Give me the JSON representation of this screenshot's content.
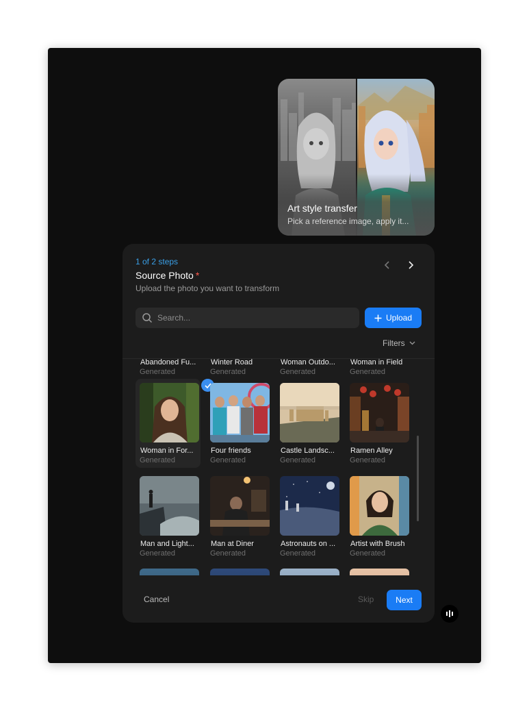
{
  "style_card": {
    "title": "Art style transfer",
    "description": "Pick a reference image, apply it..."
  },
  "dialog": {
    "step_label": "1 of 2 steps",
    "title": "Source Photo",
    "required_mark": "*",
    "subtitle": "Upload the photo you want to transform",
    "search_placeholder": "Search...",
    "upload_label": "Upload",
    "filters_label": "Filters",
    "cancel_label": "Cancel",
    "skip_label": "Skip",
    "next_label": "Next"
  },
  "gallery": {
    "partial_top": [
      {
        "name": "Abandoned Fu...",
        "sub": "Generated"
      },
      {
        "name": "Winter Road",
        "sub": "Generated"
      },
      {
        "name": "Woman Outdo...",
        "sub": "Generated"
      },
      {
        "name": "Woman in Field",
        "sub": "Generated"
      }
    ],
    "row1": [
      {
        "name": "Woman in For...",
        "sub": "Generated",
        "selected": true
      },
      {
        "name": "Four friends",
        "sub": "Generated"
      },
      {
        "name": "Castle Landsc...",
        "sub": "Generated"
      },
      {
        "name": "Ramen Alley",
        "sub": "Generated"
      }
    ],
    "row2": [
      {
        "name": "Man and Light...",
        "sub": "Generated"
      },
      {
        "name": "Man at Diner",
        "sub": "Generated"
      },
      {
        "name": "Astronauts on ...",
        "sub": "Generated"
      },
      {
        "name": "Artist with Brush",
        "sub": "Generated"
      }
    ]
  },
  "colors": {
    "accent": "#1a7cf5",
    "step_text": "#3aa0e8",
    "required": "#ff5a4d",
    "dialog_bg": "#1c1c1c",
    "stage_bg": "#0e0e0e"
  },
  "icons": [
    "chevron-left-icon",
    "chevron-right-icon",
    "search-icon",
    "plus-icon",
    "chevron-down-icon",
    "check-icon",
    "app-logo-icon"
  ]
}
